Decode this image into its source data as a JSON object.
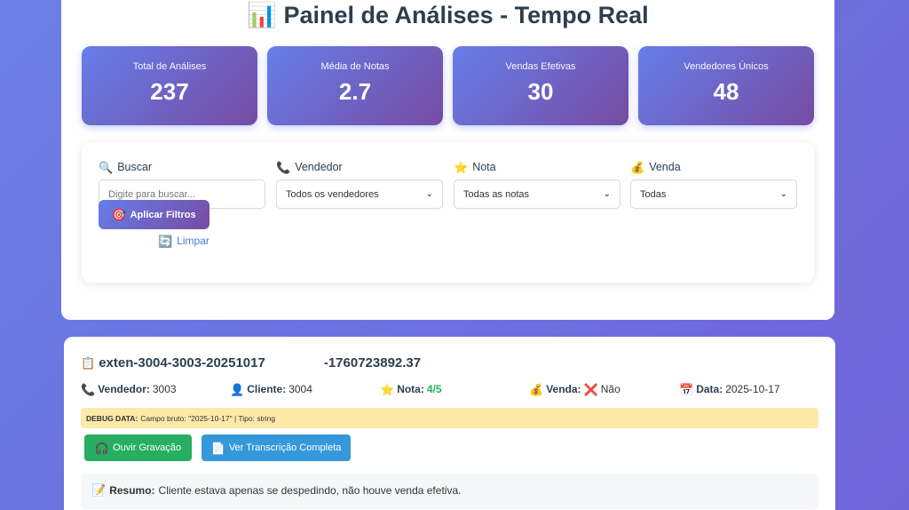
{
  "header": {
    "icon": "bar-chart-icon",
    "title": "📊 Painel de Análises - Tempo Real"
  },
  "stats": [
    {
      "label": "Total de Análises",
      "value": "237"
    },
    {
      "label": "Média de Notas",
      "value": "2.7"
    },
    {
      "label": "Vendas Efetivas",
      "value": "30"
    },
    {
      "label": "Vendedores Únicos",
      "value": "48"
    }
  ],
  "filters": {
    "search": {
      "icon": "🔍",
      "label": "Buscar",
      "placeholder": "Digite para buscar..."
    },
    "seller": {
      "icon": "📞",
      "label": "Vendedor",
      "selected": "Todos os vendedores"
    },
    "rating": {
      "icon": "⭐",
      "label": "Nota",
      "selected": "Todas as notas"
    },
    "sale": {
      "icon": "💰",
      "label": "Venda",
      "selected": "Todas"
    },
    "apply": {
      "icon": "🎯",
      "label": "Aplicar Filtros"
    },
    "clear": {
      "icon": "🔄",
      "label": "Limpar"
    }
  },
  "record": {
    "title_icon": "📋",
    "id_left": "exten-3004-3003-20251017",
    "id_right": "-1760723892.37",
    "seller": {
      "icon": "📞",
      "label": "Vendedor:",
      "value": "3003"
    },
    "client": {
      "icon": "👤",
      "label": "Cliente:",
      "value": "3004"
    },
    "rating": {
      "icon": "⭐",
      "label": "Nota:",
      "value": "4/5"
    },
    "sale": {
      "icon": "💰",
      "label": "Venda:",
      "status_icon": "❌",
      "value": "Não"
    },
    "date": {
      "icon": "📅",
      "label": "Data:",
      "value": "2025-10-17"
    },
    "debug": {
      "label": "DEBUG DATA:",
      "text": "Campo bruto: \"2025-10-17\" | Tipo: string"
    },
    "audio_button": {
      "icon": "🎧",
      "label": "Ouvir Gravação"
    },
    "transcript_button": {
      "icon": "📄",
      "label": "Ver Transcrição Completa"
    },
    "summary": {
      "icon": "📝",
      "label": "Resumo:",
      "text": "Cliente estava apenas se despedindo, não houve venda efetiva."
    }
  },
  "colors": {
    "background": "#6b7fe6",
    "stat_gradient_start": "#667eea",
    "stat_gradient_end": "#764ba2",
    "audio_button": "#27ae60",
    "transcript_button": "#3498db",
    "debug_background": "#fde9a8",
    "rating_value": "#27ae60"
  }
}
